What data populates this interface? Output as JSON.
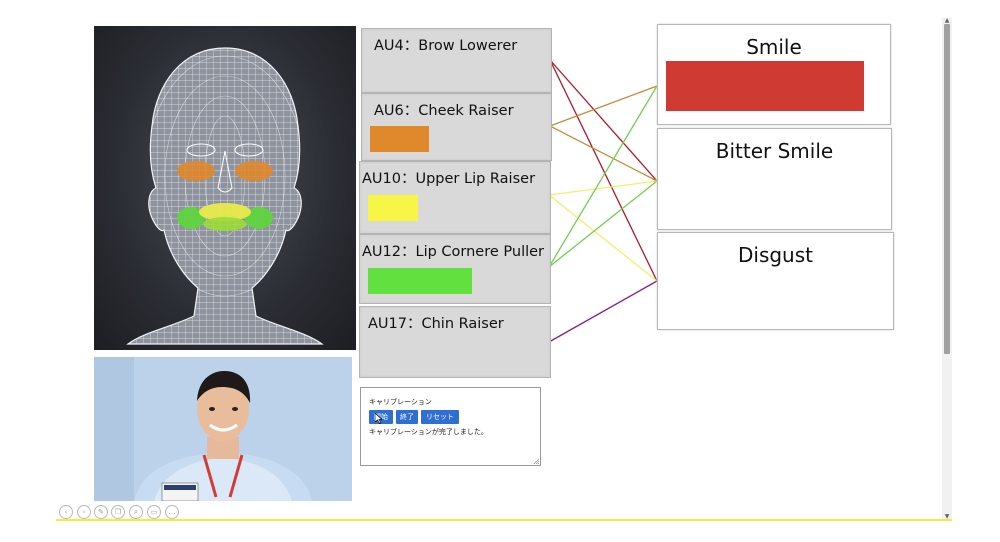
{
  "au_panels": [
    {
      "code": "AU4",
      "name": "Brow Lowerer",
      "intensity": 0.0,
      "color": "#d8d8d8"
    },
    {
      "code": "AU6",
      "name": "Cheek Raiser",
      "intensity": 0.33,
      "color": "#e0882c"
    },
    {
      "code": "AU10",
      "name": "Upper Lip Raiser",
      "intensity": 0.28,
      "color": "#f7f545"
    },
    {
      "code": "AU12",
      "name": "Lip Cornere Puller",
      "intensity": 0.58,
      "color": "#62e040"
    },
    {
      "code": "AU17",
      "name": "Chin Raiser",
      "intensity": 0.0,
      "color": "#d8d8d8"
    }
  ],
  "au_label_separator": "：",
  "emotions": [
    {
      "label": "Smile",
      "intensity": 0.87,
      "color": "#cf3a33"
    },
    {
      "label": "Bitter Smile",
      "intensity": 0.0,
      "color": "#cf3a33"
    },
    {
      "label": "Disgust",
      "intensity": 0.0,
      "color": "#cf3a33"
    }
  ],
  "connection_colors": {
    "AU4": "#b0182a",
    "AU6": "#c48a3a",
    "AU10": "#f2ef6a",
    "AU12": "#6fd04a",
    "AU17": "#8a1a8a"
  },
  "calibration": {
    "title": "キャリブレーション",
    "start_label": "開始",
    "end_label": "終了",
    "reset_label": "リセット",
    "status": "キャリブレーションが完了しました。",
    "button_color": "#2f6fd3"
  },
  "toolbar_icons": [
    "back-icon",
    "forward-icon",
    "pencil-icon",
    "copy-icon",
    "zoom-icon",
    "print-icon",
    "more-icon"
  ]
}
